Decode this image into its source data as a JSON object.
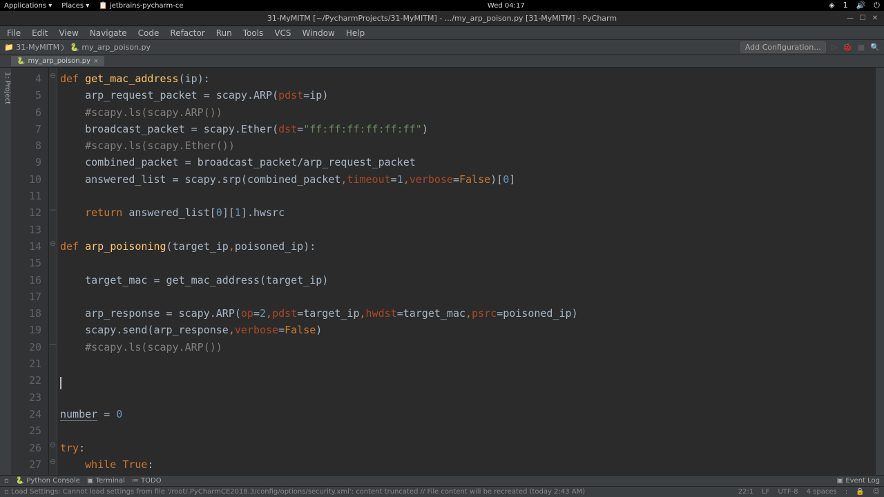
{
  "top_panel": {
    "apps": "Applications ▾",
    "places": "Places ▾",
    "running": "jetbrains-pycharm-ce",
    "clock": "Wed 04:17"
  },
  "window": {
    "title": "31-MyMITM [~/PycharmProjects/31-MyMITM] - .../my_arp_poison.py [31-MyMITM] - PyCharm"
  },
  "menu": [
    "File",
    "Edit",
    "View",
    "Navigate",
    "Code",
    "Refactor",
    "Run",
    "Tools",
    "VCS",
    "Window",
    "Help"
  ],
  "breadcrumb": {
    "project": "31-MyMITM",
    "file": "my_arp_poison.py",
    "add_config": "Add Configuration..."
  },
  "tab": {
    "name": "my_arp_poison.py"
  },
  "gutter": {
    "start": 4,
    "end": 27
  },
  "status": {
    "msg": "Load Settings: Cannot load settings from file '/root/.PyCharmCE2018.3/config/options/security.xml': content truncated // File content will be recreated (today 2:43 AM)",
    "loc": "22:1",
    "enc": "LF",
    "chset": "UTF-8",
    "indent": "4 spaces"
  },
  "tools": {
    "py_console": "Python Console",
    "terminal": "Terminal",
    "todo": "TODO",
    "event_log": "Event Log",
    "project": "1: Project"
  }
}
